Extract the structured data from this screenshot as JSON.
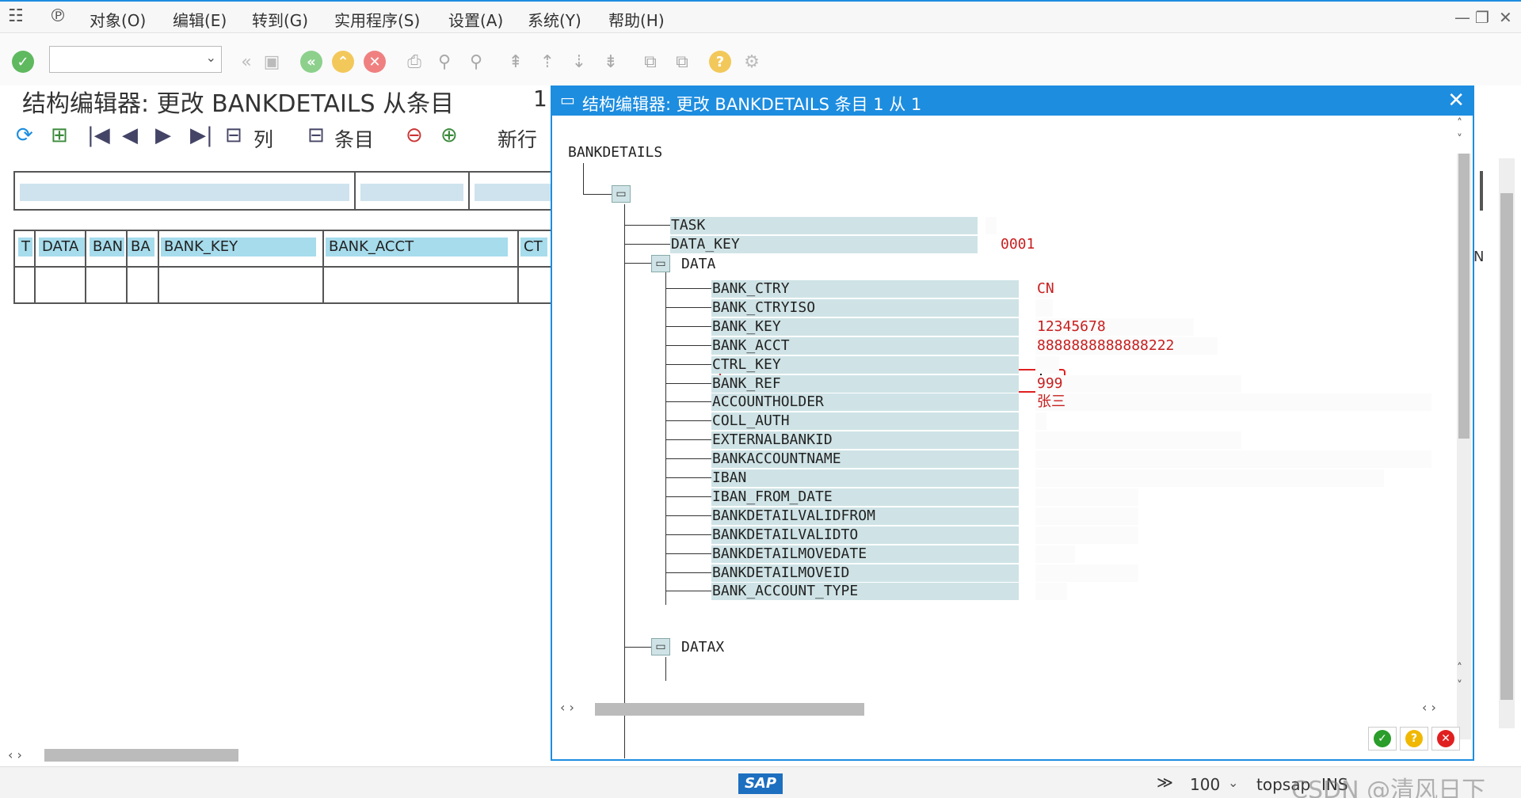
{
  "menu": {
    "items": [
      "对象(O)",
      "编辑(E)",
      "转到(G)",
      "实用程序(S)",
      "设置(A)",
      "系统(Y)",
      "帮助(H)"
    ]
  },
  "page": {
    "title": "结构编辑器: 更改 BANKDETAILS 从条目",
    "entry_number": "1",
    "toolbar": {
      "columns_label": "列",
      "entries_label": "条目",
      "new_row_label": "新行"
    },
    "table": {
      "headers": [
        "T",
        "DATA",
        "BAN",
        "BA",
        "BANK_KEY",
        "BANK_ACCT",
        "CT"
      ]
    },
    "right_header_fragment": "N"
  },
  "dialog": {
    "title": "结构编辑器: 更改 BANKDETAILS 条目 1 从 1",
    "root": "BANKDETAILS",
    "top_fields": [
      {
        "name": "TASK",
        "value": ""
      },
      {
        "name": "DATA_KEY",
        "value": "0001"
      }
    ],
    "data_node": "DATA",
    "data_fields": [
      {
        "name": "BANK_CTRY",
        "value": "CN"
      },
      {
        "name": "BANK_CTRYISO",
        "value": ""
      },
      {
        "name": "BANK_KEY",
        "value": "12345678"
      },
      {
        "name": "BANK_ACCT",
        "value": "8888888888888222"
      },
      {
        "name": "CTRL_KEY",
        "value": ""
      },
      {
        "name": "BANK_REF",
        "value": "999"
      },
      {
        "name": "ACCOUNTHOLDER",
        "value": "张三"
      },
      {
        "name": "COLL_AUTH",
        "value": ""
      },
      {
        "name": "EXTERNALBANKID",
        "value": ""
      },
      {
        "name": "BANKACCOUNTNAME",
        "value": ""
      },
      {
        "name": "IBAN",
        "value": ""
      },
      {
        "name": "IBAN_FROM_DATE",
        "value": ""
      },
      {
        "name": "BANKDETAILVALIDFROM",
        "value": ""
      },
      {
        "name": "BANKDETAILVALIDTO",
        "value": ""
      },
      {
        "name": "BANKDETAILMOVEDATE",
        "value": ""
      },
      {
        "name": "BANKDETAILMOVEID",
        "value": ""
      },
      {
        "name": "BANK_ACCOUNT_TYPE",
        "value": ""
      }
    ],
    "datax_node": "DATAX",
    "highlighted_field": "CTRL_KEY"
  },
  "status": {
    "sap_logo": "SAP",
    "zoom": "100",
    "system": "topsap",
    "mode": "INS",
    "watermark": "CSDN @清风日下"
  },
  "colors": {
    "accent": "#1d8de0",
    "value_red": "#c81e1e",
    "field_bg": "#cfe3e6",
    "highlight": "#e02020"
  }
}
